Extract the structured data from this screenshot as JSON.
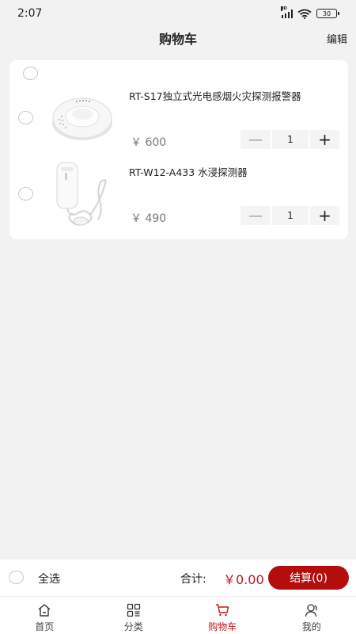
{
  "status_bar": {
    "time": "2:07",
    "network_label": "HD",
    "battery_level": "30"
  },
  "header": {
    "title": "购物车",
    "edit_label": "编辑"
  },
  "cart": {
    "items": [
      {
        "title": "RT-S17独立式光电感烟火灾探测报警器",
        "price": "￥ 600",
        "quantity": "1",
        "image": "smoke-detector"
      },
      {
        "title": "RT-W12-A433 水浸探测器",
        "price": "￥ 490",
        "quantity": "1",
        "image": "water-leak-detector"
      }
    ],
    "minus_symbol": "—",
    "plus_symbol": "+"
  },
  "checkout": {
    "select_all_label": "全选",
    "total_label": "合计:",
    "total_amount": "￥0.00",
    "checkout_button_label": "结算(0)"
  },
  "tab_bar": {
    "tabs": [
      {
        "label": "首页",
        "icon": "home-icon",
        "active": false
      },
      {
        "label": "分类",
        "icon": "category-icon",
        "active": false
      },
      {
        "label": "购物车",
        "icon": "cart-icon",
        "active": true
      },
      {
        "label": "我的",
        "icon": "profile-icon",
        "active": false
      }
    ]
  },
  "colors": {
    "accent": "#b50c0c",
    "price_red": "#c4151b",
    "background": "#f2f2f2"
  }
}
